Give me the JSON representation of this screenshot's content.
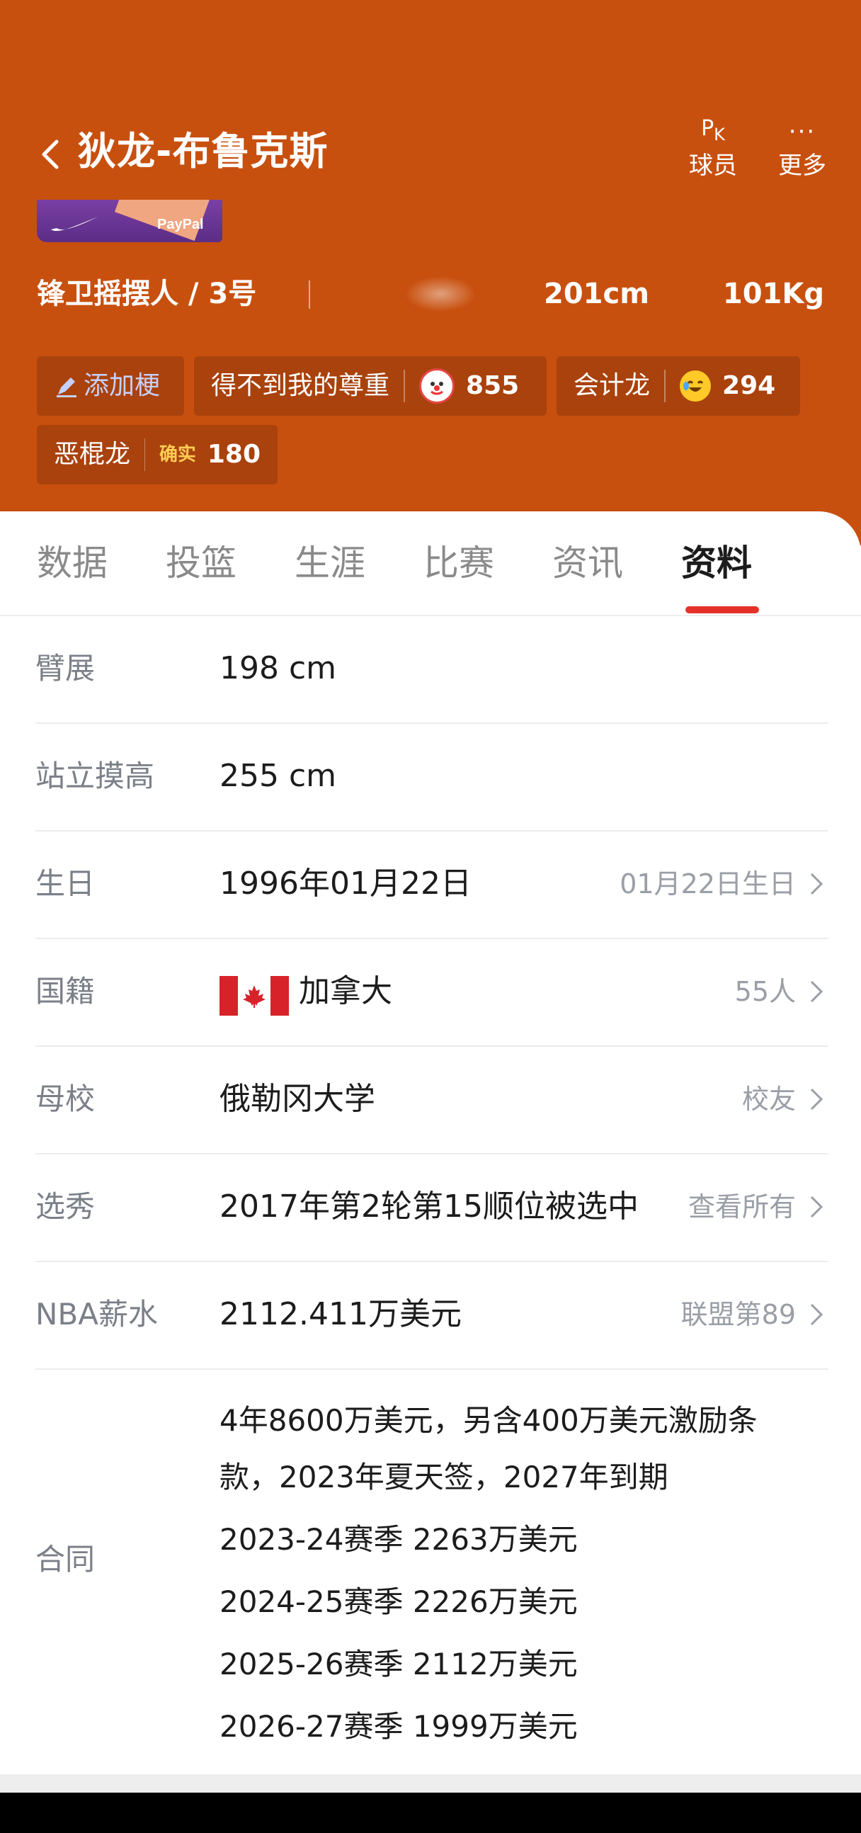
{
  "header": {
    "title": "狄龙-布鲁克斯",
    "actions": [
      {
        "label": "球员",
        "icon": "pk-icon",
        "icon_text": "P",
        "icon_sub": "K"
      },
      {
        "label": "更多",
        "icon": "more-icon",
        "icon_text": "···"
      }
    ],
    "position": "锋卫摇摆人 / 3号",
    "height": "201cm",
    "weight": "101Kg",
    "jersey_text": "PayPal",
    "tags": [
      {
        "label": "添加梗",
        "type": "add"
      },
      {
        "label": "得不到我的尊重",
        "emoji": "clown-emoji",
        "count": "855"
      },
      {
        "label": "会计龙",
        "emoji": "laugh-cry-emoji",
        "count": "294"
      },
      {
        "label": "恶棍龙",
        "badge": "确实",
        "count": "180"
      }
    ]
  },
  "tabs": [
    "数据",
    "投篮",
    "生涯",
    "比赛",
    "资讯",
    "资料"
  ],
  "active_tab": "资料",
  "profile": [
    {
      "key": "臂展",
      "value": "198 cm"
    },
    {
      "key": "站立摸高",
      "value": "255 cm"
    },
    {
      "key": "生日",
      "value": "1996年01月22日",
      "right": "01月22日生日"
    },
    {
      "key": "国籍",
      "value": "加拿大",
      "right": "55人",
      "flag": "canada-flag"
    },
    {
      "key": "母校",
      "value": "俄勒冈大学",
      "right": "校友"
    },
    {
      "key": "选秀",
      "value": "2017年第2轮第15顺位被选中",
      "right": "查看所有"
    },
    {
      "key": "NBA薪水",
      "value": "2112.411万美元",
      "right": "联盟第89"
    }
  ],
  "contract": {
    "key": "合同",
    "summary_lines": [
      "4年8600万美元，另含400万美元激励条",
      "款，2023年夏天签，2027年到期"
    ],
    "seasons": [
      "2023-24赛季 2263万美元",
      "2024-25赛季 2226万美元",
      "2025-26赛季 2112万美元",
      "2026-27赛季 1999万美元"
    ]
  },
  "colors": {
    "header_bg": "#c8500f",
    "tag_bg": "#a9420c",
    "active_underline": "#e4322b"
  }
}
